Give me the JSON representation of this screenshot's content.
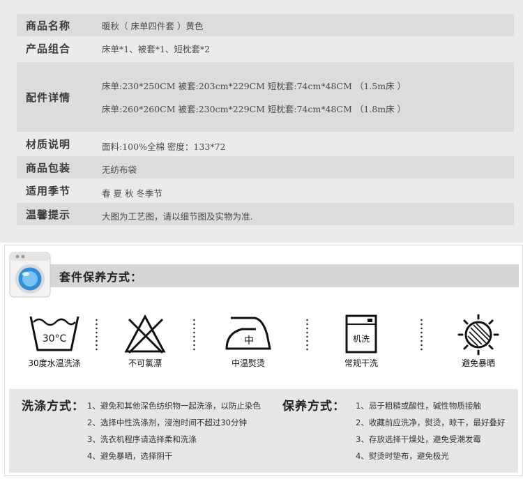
{
  "spec": {
    "rows": [
      {
        "label": "商品名称",
        "value": "暖秋（ 床单四件套 ）黄色"
      },
      {
        "label": "产品组合",
        "value": "床单*1、被套*1、短枕套*2"
      },
      {
        "label": "配件详情",
        "value": "床单:230*250CM 被套:203cm*229CM 短枕套:74cm*48CM （1.5m床 ）",
        "value2": "床单:260*260CM 被套:230cm*229CM 短枕套:74cm*48CM （1.8m床 ）"
      },
      {
        "label": "材质说明",
        "value": "面料:100%全棉 密度：133*72"
      },
      {
        "label": "商品包装",
        "value": "无纺布袋"
      },
      {
        "label": "适用季节",
        "value": "春 夏 秋 冬季节"
      },
      {
        "label": "温馨提示",
        "value": "大图为工艺图，请以细节图及实物为准."
      }
    ]
  },
  "care": {
    "title": "套件保养方式：",
    "symbols": [
      {
        "icon": "wash-30-icon",
        "inner": "30°C",
        "caption": "30度水温洗涤"
      },
      {
        "icon": "no-bleach-icon",
        "caption": "不可氯漂"
      },
      {
        "icon": "iron-medium-icon",
        "inner": "中",
        "caption": "中温熨烫"
      },
      {
        "icon": "machine-wash-icon",
        "inner": "机洗",
        "caption": "常规干洗"
      },
      {
        "icon": "avoid-sun-icon",
        "caption": "避免暴晒"
      }
    ],
    "wash": {
      "title": "洗涤方式：",
      "items": [
        "1、避免和其他深色纺织物一起洗涤，以防止染色",
        "2、选择中性洗涤剂，浸泡时间不超过30分钟",
        "3、洗衣机程序请选择柔和洗涤",
        "4、避免暴晒，选择阴干"
      ]
    },
    "maintain": {
      "title": "保养方式：",
      "items": [
        "1、忌于粗糙或酸性，碱性物质接触",
        "2、收藏前应洗净，熨烫，晾干，最好叠好",
        "3、存放选择干燥处，避免受潮发霉",
        "4、熨烫时垫布，避免极光"
      ]
    },
    "colors": {
      "header_bg": "#d6d6d6",
      "washer_blue": "#2b8fd9"
    }
  }
}
